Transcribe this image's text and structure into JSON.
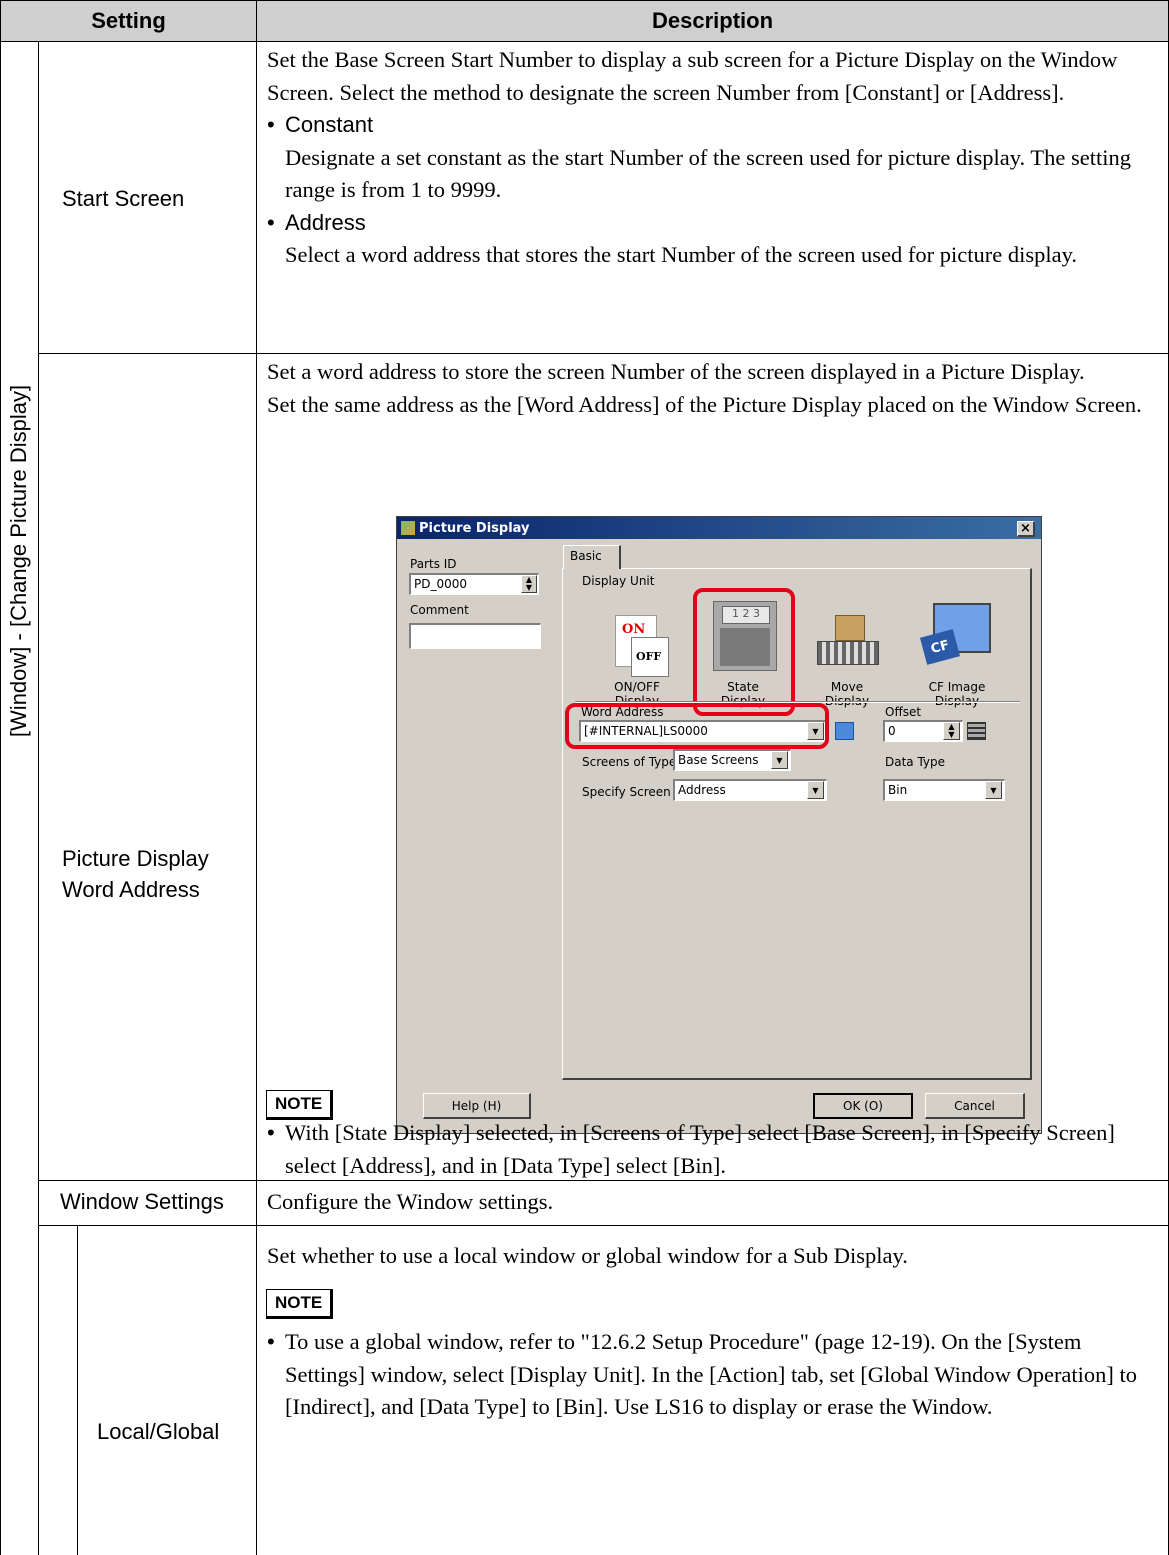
{
  "table": {
    "header": {
      "setting": "Setting",
      "description": "Description"
    },
    "group_label": "[Window] - [Change Picture Display]",
    "rows": {
      "start_screen": {
        "setting": "Start Screen",
        "intro": "Set the Base Screen Start Number to display a sub screen for a Picture Display on the Window Screen. Select the method to designate the screen Number from [Constant] or [Address].",
        "bullet1_title": "Constant",
        "bullet1_text": "Designate a set constant as the start Number of the screen used for picture display. The setting range is from 1 to 9999.",
        "bullet2_title": "Address",
        "bullet2_text": "Select a word address that stores the start Number of the screen used for picture display."
      },
      "picture_display": {
        "setting_line1": "Picture Display",
        "setting_line2": "Word Address",
        "para1": "Set a word address to store the screen Number of the screen displayed in a Picture Display.",
        "para2": "Set the same address as the [Word Address] of the Picture Display placed on the Window Screen.",
        "note_label": "NOTE",
        "note_text": "With [State Display] selected, in [Screens of Type] select [Base Screen], in [Specify Screen] select [Address], and in [Data Type] select [Bin]."
      },
      "window_settings": {
        "setting": "Window Settings",
        "description": "Configure the Window settings."
      },
      "local_global": {
        "setting": "Local/Global",
        "para1": "Set whether to use a local window or global window for a Sub Display.",
        "note_label": "NOTE",
        "note_text": "To use a global window, refer to \"12.6.2 Setup Procedure\" (page 12-19). On the [System Settings] window, select [Display Unit]. In the [Action] tab, set [Global Window Operation] to [Indirect], and [Data Type] to [Bin]. Use LS16 to display or erase the Window."
      }
    }
  },
  "dialog": {
    "title": "Picture Display",
    "close": "×",
    "parts_id_label": "Parts ID",
    "parts_id_value": "PD_0000",
    "comment_label": "Comment",
    "comment_value": "",
    "tab_basic": "Basic",
    "display_unit_label": "Display Unit",
    "units": {
      "onoff_line1": "ON/OFF",
      "onoff_line2": "Display",
      "state_line1": "State",
      "state_line2": "Display",
      "move_line1": "Move",
      "move_line2": "Display",
      "cf_line1": "CF Image",
      "cf_line2": "Display"
    },
    "onoff_icon_on": "ON",
    "onoff_icon_off": "OFF",
    "state_icon_text": "1 2 3",
    "cf_icon_text": "CF",
    "word_address_label": "Word Address",
    "word_address_value": "[#INTERNAL]LS0000",
    "offset_label": "Offset",
    "offset_value": "0",
    "screens_type_label": "Screens of Type",
    "screens_type_value": "Base Screens",
    "data_type_label": "Data Type",
    "specify_screen_label": "Specify Screen",
    "specify_screen_value": "Address",
    "data_type_value": "Bin",
    "help_button": "Help (H)",
    "ok_button": "OK (O)",
    "cancel_button": "Cancel"
  },
  "colors": {
    "header_bg": "#cfcfcf",
    "dialog_bg": "#d4d0c8",
    "highlight": "#e4001b"
  }
}
